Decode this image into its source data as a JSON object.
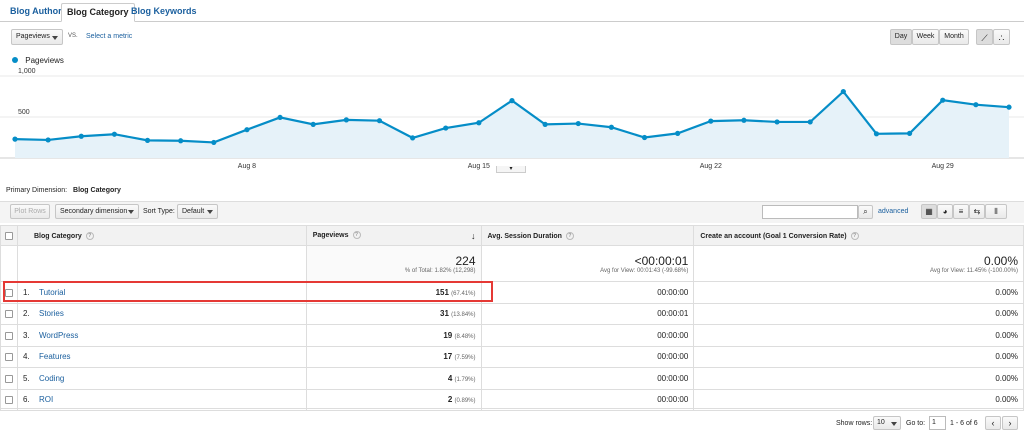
{
  "tabs": [
    "Blog Author",
    "Blog Category",
    "Blog Keywords"
  ],
  "metric": {
    "selected": "Pageviews",
    "vs": "VS.",
    "select_metric": "Select a metric"
  },
  "period_buttons": [
    "Day",
    "Week",
    "Month"
  ],
  "chart_data": {
    "type": "line",
    "series": [
      {
        "name": "Pageviews",
        "color": "#058dc7",
        "values": [
          230,
          220,
          265,
          290,
          215,
          210,
          190,
          345,
          495,
          410,
          465,
          455,
          245,
          365,
          430,
          700,
          410,
          420,
          375,
          250,
          300,
          450,
          460,
          440,
          440,
          810,
          295,
          300,
          705,
          650,
          620
        ]
      }
    ],
    "x_tick_labels": [
      "Aug 8",
      "Aug 15",
      "Aug 22",
      "Aug 29"
    ],
    "y_tick_labels": [
      "1,000",
      "500"
    ],
    "ylim": [
      0,
      1000
    ],
    "legend": "top-left"
  },
  "primary_dimension": {
    "label": "Primary Dimension:",
    "value": "Blog Category"
  },
  "controls": {
    "plot_rows": "Plot Rows",
    "secondary": "Secondary dimension",
    "sort_type": "Sort Type:",
    "sort_value": "Default",
    "advanced": "advanced"
  },
  "table": {
    "headers": [
      "Blog Category",
      "Pageviews",
      "Avg. Session Duration",
      "Create an account (Goal 1 Conversion Rate)"
    ],
    "totals": {
      "pageviews": "224",
      "pageviews_sub": "% of Total: 1.82% (12,298)",
      "duration": "<00:00:01",
      "duration_sub": "Avg for View: 00:01:43 (-99.68%)",
      "conv": "0.00%",
      "conv_sub": "Avg for View: 11.45% (-100.00%)"
    },
    "rows": [
      {
        "idx": "1.",
        "name": "Tutorial",
        "pv": "151",
        "pct": "(67.41%)",
        "dur": "00:00:00",
        "conv": "0.00%"
      },
      {
        "idx": "2.",
        "name": "Stories",
        "pv": "31",
        "pct": "(13.84%)",
        "dur": "00:00:01",
        "conv": "0.00%"
      },
      {
        "idx": "3.",
        "name": "WordPress",
        "pv": "19",
        "pct": "(8.48%)",
        "dur": "00:00:00",
        "conv": "0.00%"
      },
      {
        "idx": "4.",
        "name": "Features",
        "pv": "17",
        "pct": "(7.59%)",
        "dur": "00:00:00",
        "conv": "0.00%"
      },
      {
        "idx": "5.",
        "name": "Coding",
        "pv": "4",
        "pct": "(1.79%)",
        "dur": "00:00:00",
        "conv": "0.00%"
      },
      {
        "idx": "6.",
        "name": "ROI",
        "pv": "2",
        "pct": "(0.89%)",
        "dur": "00:00:00",
        "conv": "0.00%"
      }
    ]
  },
  "footer": {
    "show_rows": "Show rows:",
    "rows_value": "10",
    "goto": "Go to:",
    "goto_value": "1",
    "range": "1 - 6 of 6"
  },
  "highlight_color": "#e53935"
}
